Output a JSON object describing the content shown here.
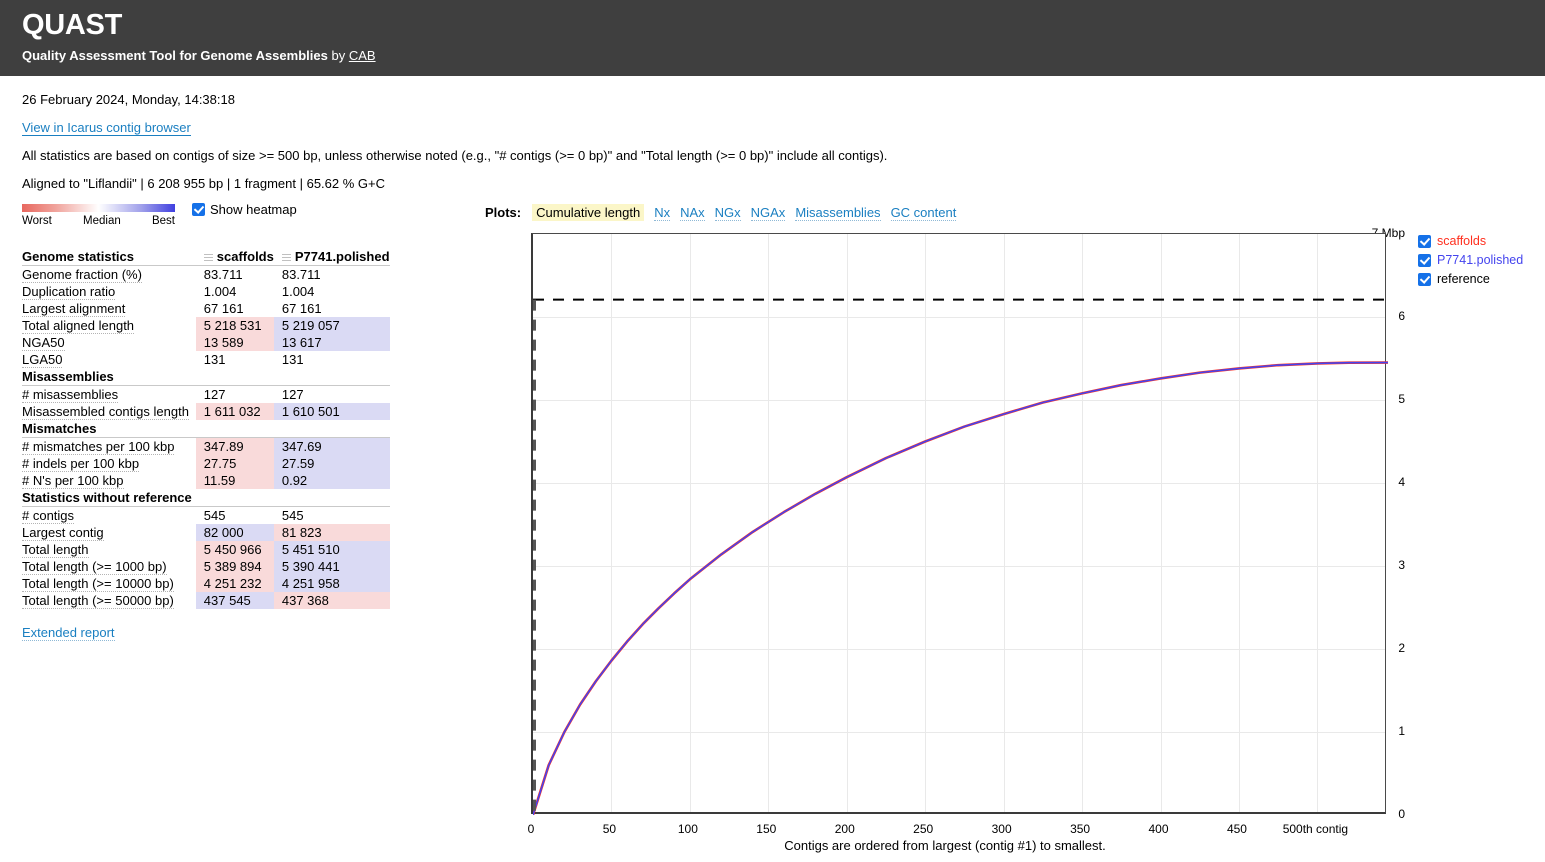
{
  "header": {
    "title": "QUAST",
    "subtitle_bold": "Quality Assessment Tool for Genome Assemblies",
    "subtitle_by": "by",
    "subtitle_link": "CAB"
  },
  "info": {
    "timestamp": "26 February 2024, Monday, 14:38:18",
    "icarus_link": "View in Icarus contig browser",
    "stats_note": "All statistics are based on contigs of size >= 500 bp, unless otherwise noted (e.g., \"# contigs (>= 0 bp)\" and \"Total length (>= 0 bp)\" include all contigs).",
    "reference_line": "Aligned to \"Liflandii\" | 6 208 955 bp | 1 fragment | 65.62 % G+C"
  },
  "heatmap": {
    "worst_label": "Worst",
    "median_label": "Median",
    "best_label": "Best",
    "show_heatmap_label": "Show heatmap",
    "show_heatmap_checked": true,
    "worst_color": "#f9dada",
    "best_color": "#dadaf4",
    "gradient_worst": "#e8685f",
    "gradient_best": "#4040e0"
  },
  "table": {
    "columns": [
      "scaffolds",
      "P7741.polished"
    ],
    "sections": [
      {
        "title": "Genome statistics",
        "rows": [
          {
            "metric": "Genome fraction (%)",
            "values": [
              "83.711",
              "83.711"
            ],
            "highlight": [
              "none",
              "none"
            ]
          },
          {
            "metric": "Duplication ratio",
            "values": [
              "1.004",
              "1.004"
            ],
            "highlight": [
              "none",
              "none"
            ]
          },
          {
            "metric": "Largest alignment",
            "values": [
              "67 161",
              "67 161"
            ],
            "highlight": [
              "none",
              "none"
            ]
          },
          {
            "metric": "Total aligned length",
            "values": [
              "5 218 531",
              "5 219 057"
            ],
            "highlight": [
              "worst",
              "best"
            ]
          },
          {
            "metric": "NGA50",
            "values": [
              "13 589",
              "13 617"
            ],
            "highlight": [
              "worst",
              "best"
            ]
          },
          {
            "metric": "LGA50",
            "values": [
              "131",
              "131"
            ],
            "highlight": [
              "none",
              "none"
            ]
          }
        ]
      },
      {
        "title": "Misassemblies",
        "rows": [
          {
            "metric": "# misassemblies",
            "values": [
              "127",
              "127"
            ],
            "highlight": [
              "none",
              "none"
            ]
          },
          {
            "metric": "Misassembled contigs length",
            "values": [
              "1 611 032",
              "1 610 501"
            ],
            "highlight": [
              "worst",
              "best"
            ]
          }
        ]
      },
      {
        "title": "Mismatches",
        "rows": [
          {
            "metric": "# mismatches per 100 kbp",
            "values": [
              "347.89",
              "347.69"
            ],
            "highlight": [
              "worst",
              "best"
            ]
          },
          {
            "metric": "# indels per 100 kbp",
            "values": [
              "27.75",
              "27.59"
            ],
            "highlight": [
              "worst",
              "best"
            ]
          },
          {
            "metric": "# N's per 100 kbp",
            "values": [
              "11.59",
              "0.92"
            ],
            "highlight": [
              "worst",
              "best"
            ]
          }
        ]
      },
      {
        "title": "Statistics without reference",
        "rows": [
          {
            "metric": "# contigs",
            "values": [
              "545",
              "545"
            ],
            "highlight": [
              "none",
              "none"
            ]
          },
          {
            "metric": "Largest contig",
            "values": [
              "82 000",
              "81 823"
            ],
            "highlight": [
              "best",
              "worst"
            ]
          },
          {
            "metric": "Total length",
            "values": [
              "5 450 966",
              "5 451 510"
            ],
            "highlight": [
              "worst",
              "best"
            ]
          },
          {
            "metric": "Total length (>= 1000 bp)",
            "values": [
              "5 389 894",
              "5 390 441"
            ],
            "highlight": [
              "worst",
              "best"
            ]
          },
          {
            "metric": "Total length (>= 10000 bp)",
            "values": [
              "4 251 232",
              "4 251 958"
            ],
            "highlight": [
              "worst",
              "best"
            ]
          },
          {
            "metric": "Total length (>= 50000 bp)",
            "values": [
              "437 545",
              "437 368"
            ],
            "highlight": [
              "best",
              "worst"
            ]
          }
        ]
      }
    ],
    "extended_report_label": "Extended report"
  },
  "plots": {
    "label": "Plots:",
    "tabs": [
      {
        "label": "Cumulative length",
        "active": true
      },
      {
        "label": "Nx",
        "active": false
      },
      {
        "label": "NAx",
        "active": false
      },
      {
        "label": "NGx",
        "active": false
      },
      {
        "label": "NGAx",
        "active": false
      },
      {
        "label": "Misassemblies",
        "active": false
      },
      {
        "label": "GC content",
        "active": false
      }
    ],
    "footnote": "Contigs are ordered from largest (contig #1) to smallest.",
    "legend": [
      {
        "label": "scaffolds",
        "color": "#ff2f1e",
        "checked": true
      },
      {
        "label": "P7741.polished",
        "color": "#4444ee",
        "checked": true
      },
      {
        "label": "reference",
        "color": "#000000",
        "checked": true
      }
    ]
  },
  "chart_data": {
    "type": "line",
    "title": "Cumulative length",
    "xlabel": "",
    "ylabel": "7 Mbp",
    "y_unit": "Mbp",
    "ytick_top_label": "7 Mbp",
    "yticks": [
      0,
      1,
      2,
      3,
      4,
      5,
      6
    ],
    "ytick_labels": [
      "0",
      "1",
      "2",
      "3",
      "4",
      "5",
      "6"
    ],
    "ylim": [
      0,
      7
    ],
    "xticks": [
      0,
      50,
      100,
      150,
      200,
      250,
      300,
      350,
      400,
      450,
      500
    ],
    "xtick_labels": [
      "0",
      "50",
      "100",
      "150",
      "200",
      "250",
      "300",
      "350",
      "400",
      "450",
      "500th contig"
    ],
    "xlim": [
      0,
      545
    ],
    "grid": true,
    "legend_position": "right",
    "series": [
      {
        "name": "scaffolds",
        "color": "#ff2f1e",
        "style": "solid",
        "x": [
          0,
          10,
          20,
          30,
          40,
          50,
          60,
          70,
          80,
          90,
          100,
          120,
          140,
          160,
          180,
          200,
          225,
          250,
          275,
          300,
          325,
          350,
          375,
          400,
          425,
          450,
          475,
          500,
          520,
          545
        ],
        "y": [
          0,
          0.6,
          1.0,
          1.33,
          1.61,
          1.86,
          2.09,
          2.3,
          2.49,
          2.67,
          2.84,
          3.14,
          3.41,
          3.65,
          3.87,
          4.07,
          4.3,
          4.5,
          4.68,
          4.83,
          4.97,
          5.08,
          5.18,
          5.26,
          5.33,
          5.38,
          5.42,
          5.44,
          5.45,
          5.451
        ]
      },
      {
        "name": "P7741.polished",
        "color": "#4444ee",
        "style": "solid",
        "x": [
          0,
          10,
          20,
          30,
          40,
          50,
          60,
          70,
          80,
          90,
          100,
          120,
          140,
          160,
          180,
          200,
          225,
          250,
          275,
          300,
          325,
          350,
          375,
          400,
          425,
          450,
          475,
          500,
          520,
          545
        ],
        "y": [
          0,
          0.6,
          1.0,
          1.33,
          1.61,
          1.86,
          2.09,
          2.3,
          2.49,
          2.67,
          2.84,
          3.14,
          3.41,
          3.65,
          3.87,
          4.07,
          4.3,
          4.5,
          4.68,
          4.83,
          4.97,
          5.08,
          5.18,
          5.26,
          5.33,
          5.38,
          5.42,
          5.44,
          5.45,
          5.4515
        ]
      },
      {
        "name": "reference",
        "color": "#000000",
        "style": "dashed",
        "constant_y": 6.209
      }
    ]
  }
}
